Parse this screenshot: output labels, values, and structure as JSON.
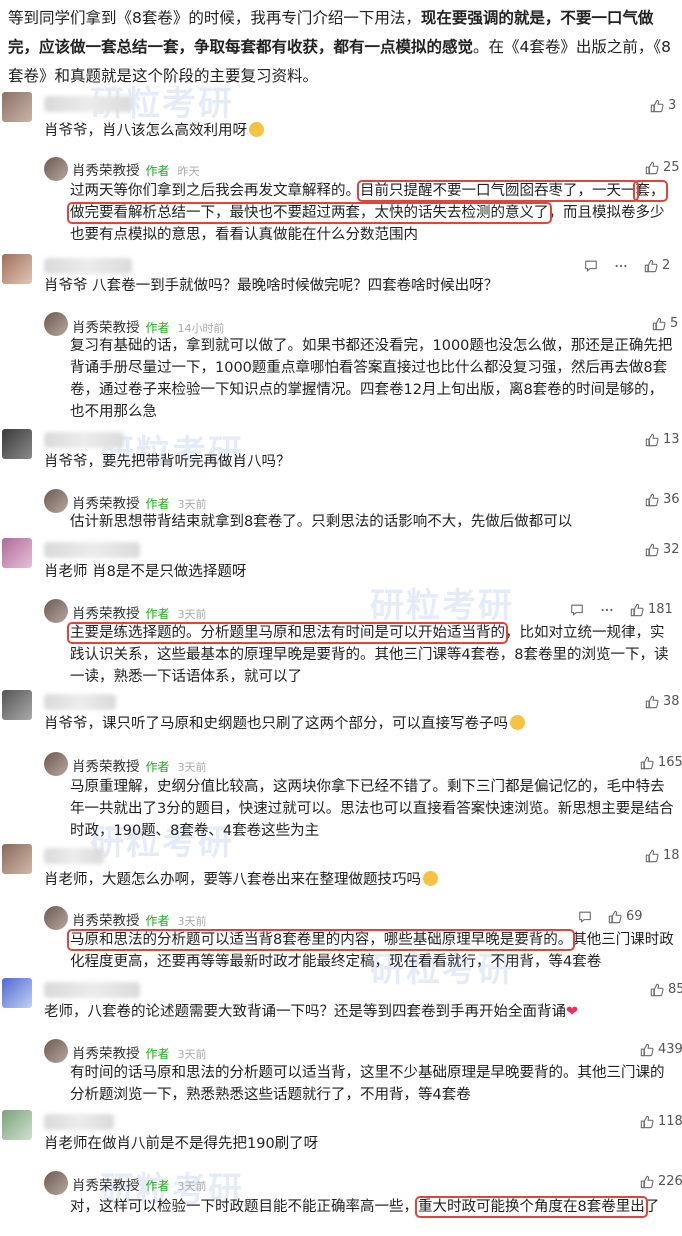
{
  "intro": {
    "part1": "等到同学们拿到《8套卷》的时候，我再专门介绍一下用法，",
    "part2_bold": "现在要强调的就是，不要一口气做完，应该做一套总结一套，争取每套都有收获，都有一点模拟的感觉",
    "part3": "。在《4套卷》出版之前，《8套卷》和真题就是这个阶段的主要复习资料。"
  },
  "watermark": "研粒考研",
  "author": {
    "name": "肖秀荣教授",
    "tag": "作者"
  },
  "comments": [
    {
      "likes": "3",
      "text": "肖爷爷，肖八该怎么高效利用呀",
      "reply": {
        "time": "昨天",
        "likes": "25",
        "pre": "过两天等你们拿到之后我会再发文章解释的。",
        "hl1": "目前只提醒不要一口气囫囵吞枣了，一天一",
        "hl2": "套，做完要看解析总结一下，最快也不要超过两套，太快的话失去检测的意义了",
        "post": "，而且模拟卷多少也要有点模拟的意思，看看认真做能在什么分数范围内"
      }
    },
    {
      "likes": "2",
      "text": "肖爷爷 八套卷一到手就做吗？最晚啥时候做完呢？四套卷啥时候出呀？",
      "reply": {
        "time": "14小时前",
        "likes": "5",
        "pre": "复习有基础的话，拿到就可以做了。如果书都还没看完，1000题也没怎么做，那还是正确先把背诵手册尽量过一下，1000题重点章哪怕看答案直接过也比什么都没复习强，然后再去做8套卷，通过卷子来检验一下知识点的掌握情况。四套卷12月上旬出版，离8套卷的时间是够的，也不用那么急"
      }
    },
    {
      "likes": "13",
      "text": "肖爷爷，要先把带背听完再做肖八吗？",
      "reply": {
        "time": "3天前",
        "likes": "36",
        "pre": "估计新思想带背结束就拿到8套卷了。只剩思法的话影响不大，先做后做都可以"
      }
    },
    {
      "likes": "32",
      "text": "肖老师 肖8是不是只做选择题呀",
      "reply": {
        "time": "3天前",
        "likes": "181",
        "hl1": "主要是练选择题的。分析题里马原和思法有时间是可以开始适当背的",
        "post": "，比如对立统一规律，实践认识关系，这些最基本的原理早晚是要背的。其他三门课等4套卷，8套卷里的浏览一下，读一读，熟悉一下话语体系，就可以了"
      }
    },
    {
      "likes": "38",
      "text": "肖爷爷，课只听了马原和史纲题也只刷了这两个部分，可以直接写卷子吗",
      "reply": {
        "time": "3天前",
        "likes": "165",
        "pre": "马原重理解，史纲分值比较高，这两块你拿下已经不错了。剩下三门都是偏记忆的，毛中特去年一共就出了3分的题目，快速过就可以。思法也可以直接看答案快速浏览。新思想主要是结合时政，190题、8套卷、4套卷这些为主"
      }
    },
    {
      "likes": "18",
      "text": "肖老师，大题怎么办啊，要等八套卷出来在整理做题技巧吗",
      "reply": {
        "time": "3天前",
        "likes": "69",
        "hl1": "马原和思法的分析题可以适当背8套卷里的内容，哪些基础原理早晚是要背的。",
        "post": "其他三门课时政化程度更高，还要再等等最新时政才能最终定稿，现在看看就行，不用背，等4套卷"
      }
    },
    {
      "likes": "85",
      "text": "老师，八套卷的论述题需要大致背诵一下吗？还是等到四套卷到手再开始全面背诵",
      "reply": {
        "time": "3天前",
        "likes": "439",
        "pre": "有时间的话马原和思法的分析题可以适当背，这里不少基础原理是早晚要背的。其他三门课的分析题浏览一下，熟悉熟悉这些话题就行了，不用背，等4套卷"
      }
    },
    {
      "likes": "118",
      "text": "肖老师在做肖八前是不是得先把190刷了呀",
      "reply": {
        "time": "3天前",
        "likes": "226",
        "pre": "对，这样可以检验一下时政题目能不能正确率高一些，",
        "hl1": "重大时政可能换个角度在8套卷里出",
        "post": "了"
      }
    }
  ]
}
